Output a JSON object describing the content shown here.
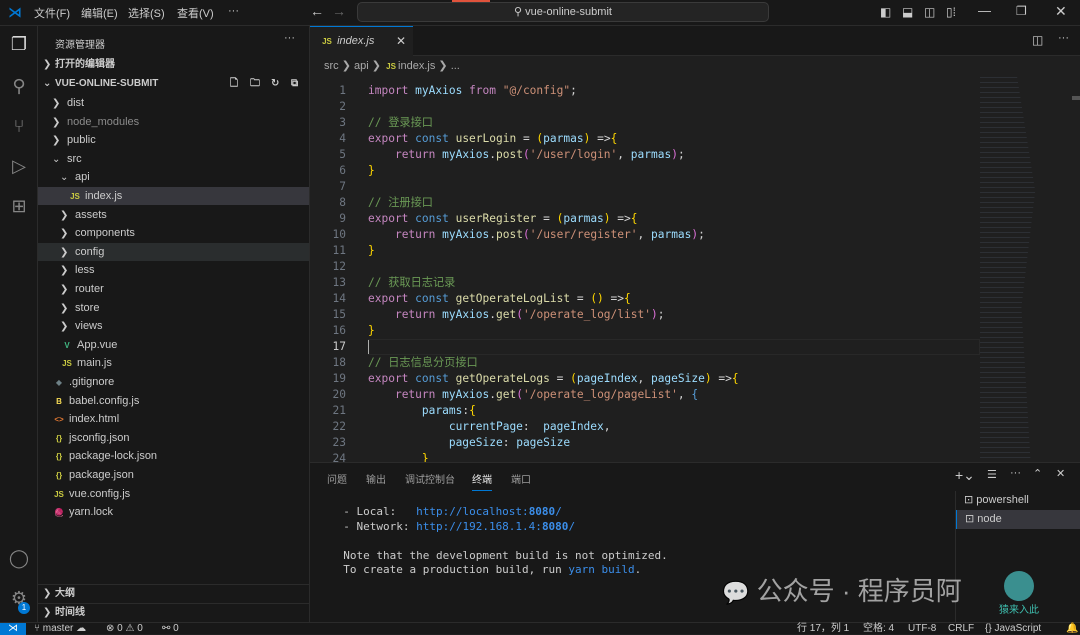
{
  "titlebar": {
    "menus": [
      "文件(F)",
      "编辑(E)",
      "选择(S)",
      "查看(V)",
      "···"
    ],
    "search": "vue-online-submit"
  },
  "sidebar": {
    "title": "资源管理器",
    "open_editors": "打开的编辑器",
    "root": "VUE-ONLINE-SUBMIT",
    "outline": "大纲",
    "timeline": "时间线",
    "items": [
      {
        "label": "dist",
        "type": "folder",
        "level": 0
      },
      {
        "label": "node_modules",
        "type": "folder",
        "level": 0,
        "dim": true
      },
      {
        "label": "public",
        "type": "folder",
        "level": 0
      },
      {
        "label": "src",
        "type": "folder-open",
        "level": 0
      },
      {
        "label": "api",
        "type": "folder-open",
        "level": 1
      },
      {
        "label": "index.js",
        "type": "js",
        "level": 2,
        "selected": true
      },
      {
        "label": "assets",
        "type": "folder",
        "level": 1
      },
      {
        "label": "components",
        "type": "folder",
        "level": 1
      },
      {
        "label": "config",
        "type": "folder",
        "level": 1,
        "hover": true
      },
      {
        "label": "less",
        "type": "folder",
        "level": 1
      },
      {
        "label": "router",
        "type": "folder",
        "level": 1
      },
      {
        "label": "store",
        "type": "folder",
        "level": 1
      },
      {
        "label": "views",
        "type": "folder",
        "level": 1
      },
      {
        "label": "App.vue",
        "type": "vue",
        "level": 1
      },
      {
        "label": "main.js",
        "type": "js",
        "level": 1
      },
      {
        "label": ".gitignore",
        "type": "git",
        "level": 0
      },
      {
        "label": "babel.config.js",
        "type": "babel",
        "level": 0
      },
      {
        "label": "index.html",
        "type": "html",
        "level": 0
      },
      {
        "label": "jsconfig.json",
        "type": "json",
        "level": 0
      },
      {
        "label": "package-lock.json",
        "type": "json",
        "level": 0
      },
      {
        "label": "package.json",
        "type": "json",
        "level": 0
      },
      {
        "label": "vue.config.js",
        "type": "js",
        "level": 0
      },
      {
        "label": "yarn.lock",
        "type": "yarn",
        "level": 0
      }
    ]
  },
  "editor": {
    "tab": "index.js",
    "breadcrumb": [
      "src",
      "api",
      "index.js",
      "..."
    ],
    "lines": [
      [
        [
          "kw",
          "import "
        ],
        [
          "vr",
          "myAxios "
        ],
        [
          "kw",
          "from "
        ],
        [
          "str",
          "\"@/config\""
        ],
        [
          "p",
          ";"
        ]
      ],
      [],
      [
        [
          "cm",
          "// 登录接口"
        ]
      ],
      [
        [
          "kw",
          "export "
        ],
        [
          "st",
          "const "
        ],
        [
          "fn",
          "userLogin"
        ],
        [
          "p",
          " = "
        ],
        [
          "b1",
          "("
        ],
        [
          "vr",
          "parmas"
        ],
        [
          "b1",
          ")"
        ],
        [
          "p",
          " =>"
        ],
        [
          "b1",
          "{"
        ]
      ],
      [
        [
          "p",
          "    "
        ],
        [
          "kw",
          "return "
        ],
        [
          "vr",
          "myAxios"
        ],
        [
          "p",
          "."
        ],
        [
          "fn",
          "post"
        ],
        [
          "b2",
          "("
        ],
        [
          "str",
          "'/user/login'"
        ],
        [
          "p",
          ", "
        ],
        [
          "vr",
          "parmas"
        ],
        [
          "b2",
          ")"
        ],
        [
          "p",
          ";"
        ]
      ],
      [
        [
          "b1",
          "}"
        ]
      ],
      [],
      [
        [
          "cm",
          "// 注册接口"
        ]
      ],
      [
        [
          "kw",
          "export "
        ],
        [
          "st",
          "const "
        ],
        [
          "fn",
          "userRegister"
        ],
        [
          "p",
          " = "
        ],
        [
          "b1",
          "("
        ],
        [
          "vr",
          "parmas"
        ],
        [
          "b1",
          ")"
        ],
        [
          "p",
          " =>"
        ],
        [
          "b1",
          "{"
        ]
      ],
      [
        [
          "p",
          "    "
        ],
        [
          "kw",
          "return "
        ],
        [
          "vr",
          "myAxios"
        ],
        [
          "p",
          "."
        ],
        [
          "fn",
          "post"
        ],
        [
          "b2",
          "("
        ],
        [
          "str",
          "'/user/register'"
        ],
        [
          "p",
          ", "
        ],
        [
          "vr",
          "parmas"
        ],
        [
          "b2",
          ")"
        ],
        [
          "p",
          ";"
        ]
      ],
      [
        [
          "b1",
          "}"
        ]
      ],
      [],
      [
        [
          "cm",
          "// 获取日志记录"
        ]
      ],
      [
        [
          "kw",
          "export "
        ],
        [
          "st",
          "const "
        ],
        [
          "fn",
          "getOperateLogList"
        ],
        [
          "p",
          " = "
        ],
        [
          "b1",
          "()"
        ],
        [
          "p",
          " =>"
        ],
        [
          "b1",
          "{"
        ]
      ],
      [
        [
          "p",
          "    "
        ],
        [
          "kw",
          "return "
        ],
        [
          "vr",
          "myAxios"
        ],
        [
          "p",
          "."
        ],
        [
          "fn",
          "get"
        ],
        [
          "b2",
          "("
        ],
        [
          "str",
          "'/operate_log/list'"
        ],
        [
          "b2",
          ")"
        ],
        [
          "p",
          ";"
        ]
      ],
      [
        [
          "b1",
          "}"
        ]
      ],
      [],
      [
        [
          "cm",
          "// 日志信息分页接口"
        ]
      ],
      [
        [
          "kw",
          "export "
        ],
        [
          "st",
          "const "
        ],
        [
          "fn",
          "getOperateLogs"
        ],
        [
          "p",
          " = "
        ],
        [
          "b1",
          "("
        ],
        [
          "vr",
          "pageIndex"
        ],
        [
          "p",
          ", "
        ],
        [
          "vr",
          "pageSize"
        ],
        [
          "b1",
          ")"
        ],
        [
          "p",
          " =>"
        ],
        [
          "b1",
          "{"
        ]
      ],
      [
        [
          "p",
          "    "
        ],
        [
          "kw",
          "return "
        ],
        [
          "vr",
          "myAxios"
        ],
        [
          "p",
          "."
        ],
        [
          "fn",
          "get"
        ],
        [
          "b2",
          "("
        ],
        [
          "str",
          "'/operate_log/pageList'"
        ],
        [
          "p",
          ", "
        ],
        [
          "st",
          "{"
        ]
      ],
      [
        [
          "p",
          "        "
        ],
        [
          "vr",
          "params"
        ],
        [
          "p",
          ":"
        ],
        [
          "b1",
          "{"
        ]
      ],
      [
        [
          "p",
          "            "
        ],
        [
          "vr",
          "currentPage"
        ],
        [
          "p",
          ":  "
        ],
        [
          "vr",
          "pageIndex"
        ],
        [
          "p",
          ","
        ]
      ],
      [
        [
          "p",
          "            "
        ],
        [
          "vr",
          "pageSize"
        ],
        [
          "p",
          ": "
        ],
        [
          "vr",
          "pageSize"
        ]
      ],
      [
        [
          "p",
          "        "
        ],
        [
          "b1",
          "}"
        ]
      ]
    ]
  },
  "panel": {
    "tabs": [
      "问题",
      "输出",
      "调试控制台",
      "终端",
      "端口"
    ],
    "active_tab": "终端",
    "terminal": [
      [
        [
          "p",
          "  - Local:   "
        ],
        [
          "url",
          "http://localhost:"
        ],
        [
          "urlb",
          "8080"
        ],
        [
          "url",
          "/"
        ]
      ],
      [
        [
          "p",
          "  - Network: "
        ],
        [
          "url",
          "http://192.168.1.4:"
        ],
        [
          "urlb",
          "8080"
        ],
        [
          "url",
          "/"
        ]
      ],
      [],
      [
        [
          "p",
          "  Note that the development build is not optimized."
        ]
      ],
      [
        [
          "p",
          "  To create a production build, run "
        ],
        [
          "url",
          "yarn build"
        ],
        [
          "p",
          "."
        ]
      ]
    ],
    "shells": [
      "powershell",
      "node"
    ],
    "active_shell": "node"
  },
  "statusbar": {
    "branch": "master",
    "errors": "0",
    "warnings": "0",
    "ports": "0",
    "position": "行 17，列 1",
    "spaces": "空格: 4",
    "encoding": "UTF-8",
    "eol": "CRLF",
    "language": "JavaScript"
  },
  "watermark": {
    "text": "公众号 · 程序员阿",
    "logo_text": "猿来入此 www.yuanlrc.com"
  },
  "badges": {
    "settings": "1"
  },
  "colors": {
    "accent": "#0078d4",
    "js": "#cbcb41",
    "vue": "#41b883",
    "json": "#cbcb41"
  }
}
